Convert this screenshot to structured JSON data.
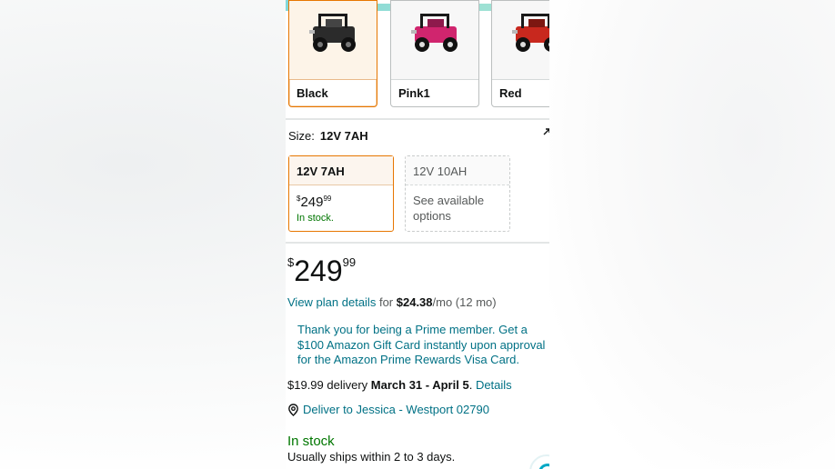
{
  "colors": {
    "selected_label": "Black",
    "options": [
      {
        "label": "Black",
        "car_color": "#2b2b2b"
      },
      {
        "label": "Pink1",
        "car_color": "#d0256e"
      },
      {
        "label": "Red",
        "car_color": "#c8281e"
      }
    ]
  },
  "size": {
    "label": "Size:",
    "selected_value": "12V 7AH",
    "options": [
      {
        "name": "12V 7AH",
        "price_symbol": "$",
        "price_whole": "249",
        "price_fraction": "99",
        "status": "In stock."
      },
      {
        "name": "12V 10AH",
        "status": "See available options"
      }
    ]
  },
  "price": {
    "symbol": "$",
    "whole": "249",
    "fraction": "99"
  },
  "plan": {
    "link": "View plan details",
    "for": "for",
    "amount": "$24.38",
    "per": "/mo (12 mo)"
  },
  "prime_message": "Thank you for being a Prime member. Get a $100 Amazon Gift Card instantly upon approval for the Amazon Prime Rewards Visa Card.",
  "delivery": {
    "fee": "$19.99 delivery",
    "dates": "March 31 - April 5",
    "period": ".",
    "details_link": "Details"
  },
  "deliver_to": "Deliver to Jessica - Westport 02790",
  "stock": {
    "status": "In stock",
    "ships": "Usually ships within 2 to 3 days."
  },
  "accent_colors": {
    "link": "#007185",
    "in_stock": "#007600",
    "selected_border": "#e77600"
  }
}
